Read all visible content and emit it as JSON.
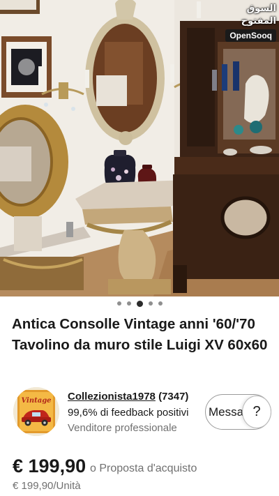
{
  "watermark": {
    "arabic": "السوق المفتوح",
    "latin": "OpenSooq"
  },
  "carousel": {
    "count": 5,
    "active": 3
  },
  "listing": {
    "title": "Antica Consolle Vintage anni '60/'70 Tavolino da muro stile Luigi XV 60x60"
  },
  "seller": {
    "avatar_text": "Vintage",
    "name": "Collezionista1978",
    "count": "(7347)",
    "feedback": "99,6% di feedback positivi",
    "type": "Venditore professionale"
  },
  "actions": {
    "message_label": "Messa",
    "help_label": "?"
  },
  "price": {
    "amount": "€ 199,90",
    "offer": "o Proposta d'acquisto",
    "unit": "€ 199,90/Unità"
  },
  "colors": {
    "text": "#191919",
    "secondary_text": "#707070",
    "dot_active": "#2b2b2b",
    "dot_inactive": "#8f8f8f"
  }
}
